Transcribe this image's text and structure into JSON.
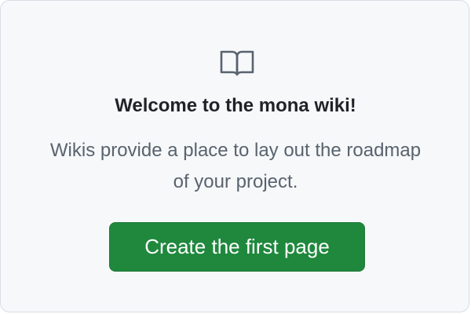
{
  "blankslate": {
    "icon": "book-icon",
    "title": "Welcome to the mona wiki!",
    "description": "Wikis provide a place to lay out the roadmap of your project.",
    "primary_button_label": "Create the first page"
  },
  "colors": {
    "background": "#f6f8fa",
    "border": "#d8dee4",
    "title": "#1f2328",
    "description": "#59636e",
    "icon": "#59636e",
    "button_bg": "#1f883d",
    "button_text": "#ffffff"
  }
}
